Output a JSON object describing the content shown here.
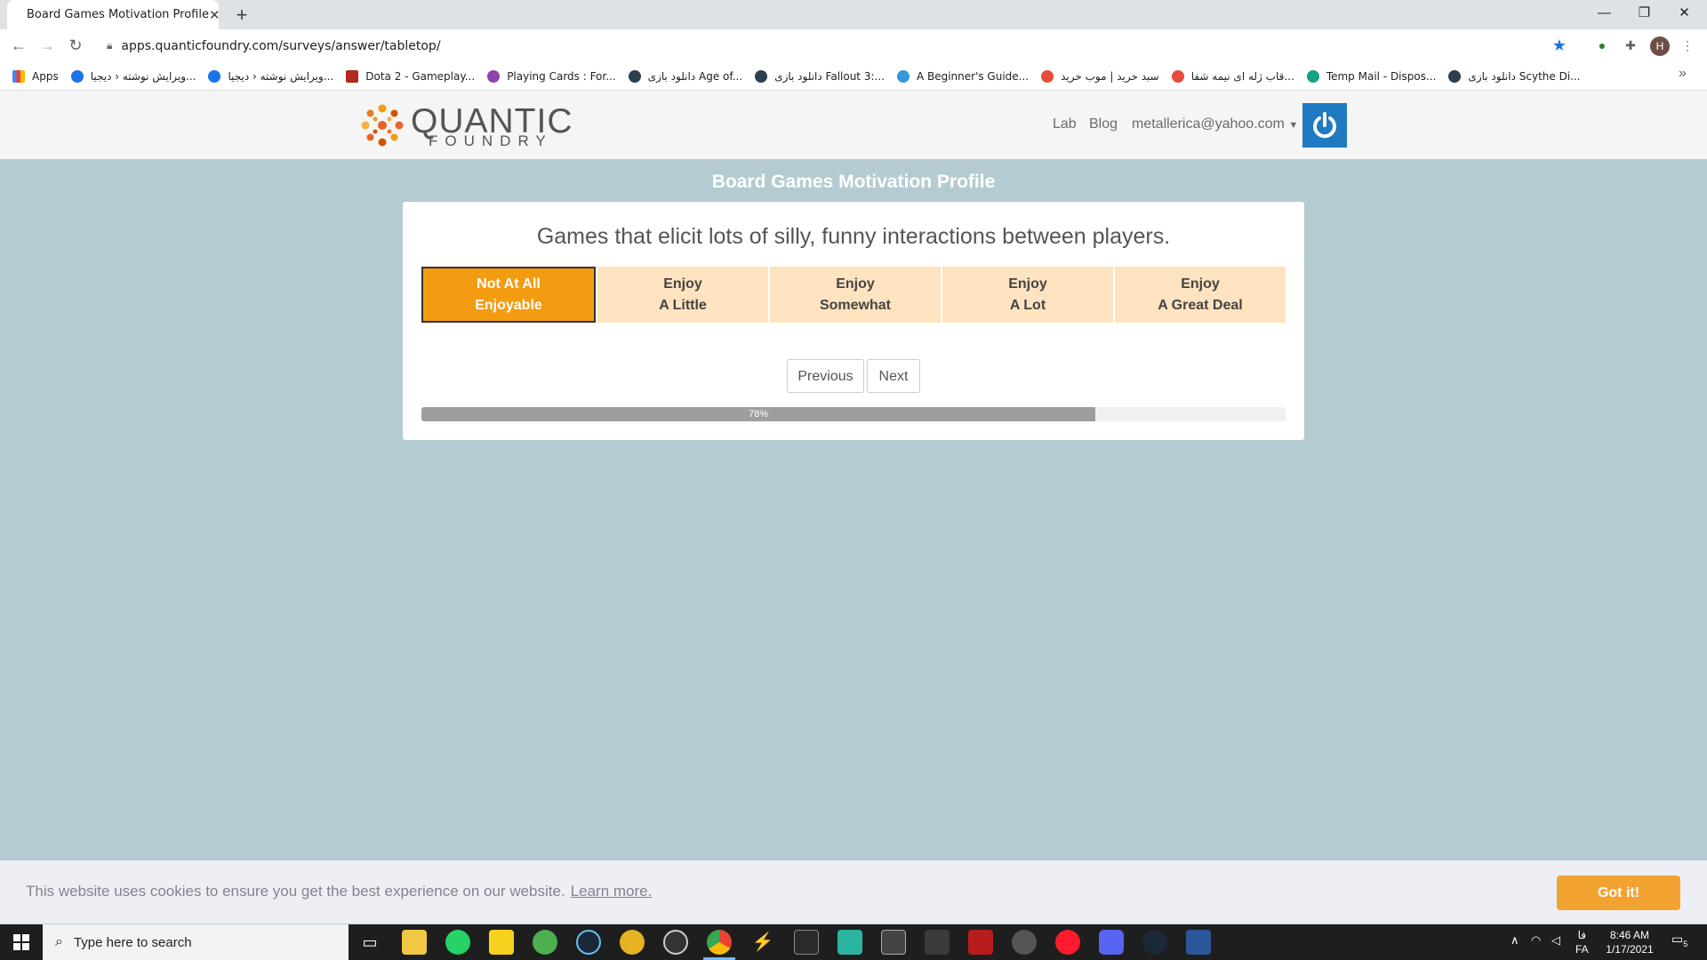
{
  "browser": {
    "tab_title": "Board Games Motivation Profile",
    "new_tab": "+",
    "url": "apps.quanticfoundry.com/surveys/answer/tabletop/",
    "profile_initial": "H",
    "bookmarks": [
      {
        "label": "Apps",
        "color": "#4285f4"
      },
      {
        "label": "ویرایش نوشته ‹ دیجیا...",
        "color": "#1a73e8"
      },
      {
        "label": "ویرایش نوشته ‹ دیجیا...",
        "color": "#1a73e8"
      },
      {
        "label": "Dota 2 - Gameplay...",
        "color": "#b02a1e"
      },
      {
        "label": "Playing Cards : For...",
        "color": "#8e44ad"
      },
      {
        "label": "دانلود بازی Age of...",
        "color": "#2c3e50"
      },
      {
        "label": "دانلود بازی Fallout 3:...",
        "color": "#2c3e50"
      },
      {
        "label": "A Beginner's Guide...",
        "color": "#3498db"
      },
      {
        "label": "سبد خرید | موب خرید",
        "color": "#e74c3c"
      },
      {
        "label": "قاب ژله ای نیمه شفا...",
        "color": "#e74c3c"
      },
      {
        "label": "Temp Mail - Dispos...",
        "color": "#16a085"
      },
      {
        "label": "دانلود بازی Scythe Di...",
        "color": "#2c3e50"
      }
    ],
    "more_bookmarks": "»"
  },
  "site": {
    "logo_top": "QUANTIC",
    "logo_bottom": "FOUNDRY",
    "nav": {
      "lab": "Lab",
      "blog": "Blog",
      "account": "metallerica@yahoo.com"
    }
  },
  "survey": {
    "page_title": "Board Games Motivation Profile",
    "question": "Games that elicit lots of silly, funny interactions between players.",
    "options": [
      {
        "line1": "Not At All",
        "line2": "Enjoyable",
        "selected": true
      },
      {
        "line1": "Enjoy",
        "line2": "A Little",
        "selected": false
      },
      {
        "line1": "Enjoy",
        "line2": "Somewhat",
        "selected": false
      },
      {
        "line1": "Enjoy",
        "line2": "A Lot",
        "selected": false
      },
      {
        "line1": "Enjoy",
        "line2": "A Great Deal",
        "selected": false
      }
    ],
    "previous_label": "Previous",
    "next_label": "Next",
    "progress_percent": 78,
    "progress_label": "78%"
  },
  "cookie": {
    "message": "This website uses cookies to ensure you get the best experience on our website.",
    "learn_more": "Learn more.",
    "accept": "Got it!"
  },
  "taskbar": {
    "search_placeholder": "Type here to search",
    "lang_top": "فا",
    "lang_bottom": "FA",
    "time": "8:46 AM",
    "date": "1/17/2021",
    "notifications": "5"
  },
  "colors": {
    "accent_orange": "#f39c12",
    "option_bg": "#fde3bf",
    "page_bg": "#b5cbd2",
    "power_blue": "#1f7ac2"
  }
}
